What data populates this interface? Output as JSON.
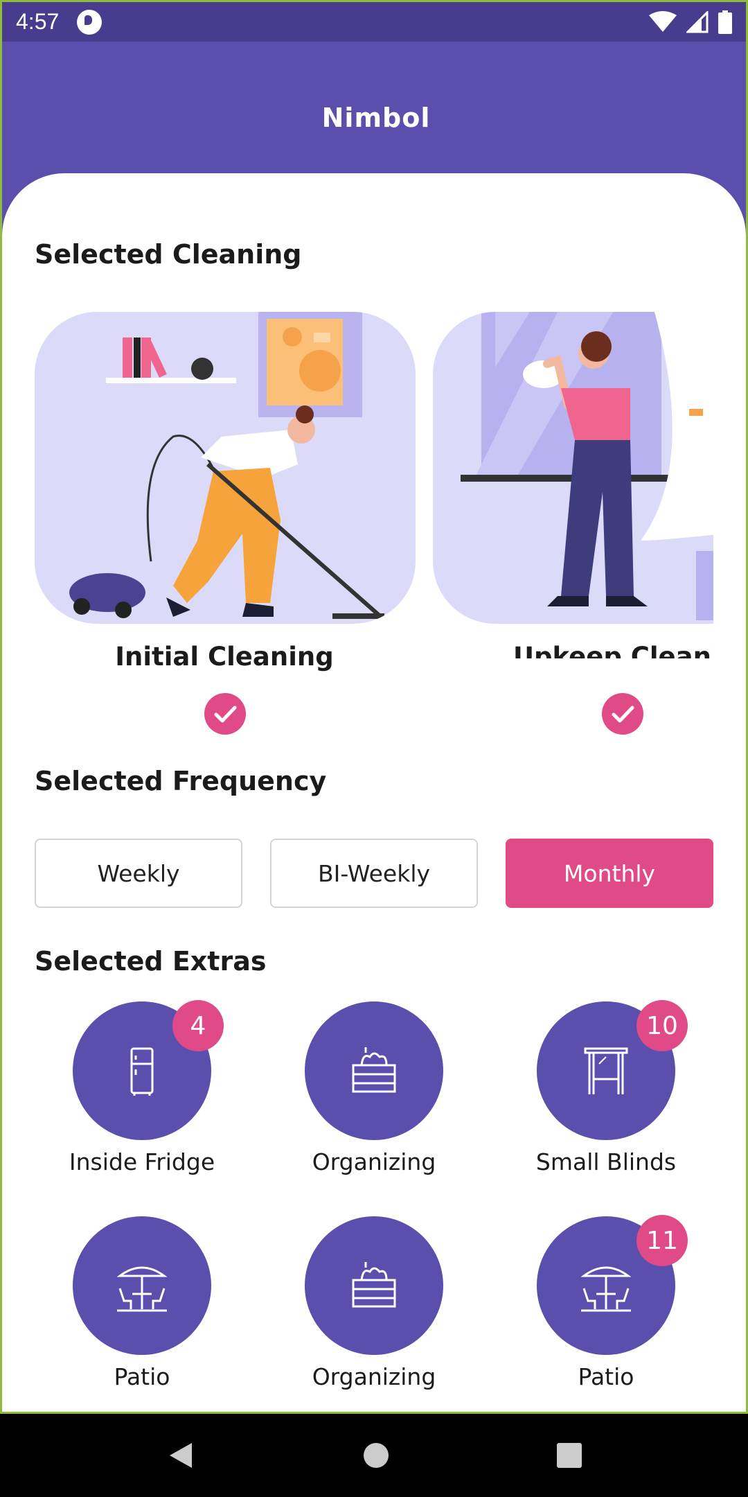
{
  "status": {
    "time": "4:57"
  },
  "app": {
    "title": "Nimbol"
  },
  "cleaning": {
    "title": "Selected Cleaning",
    "items": [
      {
        "label": "Initial Cleaning",
        "selected": true
      },
      {
        "label": "Upkeep Cleanin",
        "selected": true
      }
    ]
  },
  "frequency": {
    "title": "Selected Frequency",
    "options": [
      "Weekly",
      "BI-Weekly",
      "Monthly"
    ],
    "selected": "Monthly"
  },
  "extras": {
    "title": "Selected Extras",
    "items": [
      {
        "label": "Inside Fridge",
        "icon": "fridge-icon",
        "badge": "4"
      },
      {
        "label": "Organizing",
        "icon": "crate-icon",
        "badge": ""
      },
      {
        "label": "Small Blinds",
        "icon": "blinds-icon",
        "badge": "10"
      },
      {
        "label": "Patio",
        "icon": "patio-icon",
        "badge": ""
      },
      {
        "label": "Organizing",
        "icon": "crate-icon",
        "badge": ""
      },
      {
        "label": "Patio",
        "icon": "patio-icon",
        "badge": "11"
      }
    ]
  },
  "colors": {
    "primary": "#5b4fae",
    "accent": "#df4a87",
    "status_bar": "#473c8e"
  }
}
